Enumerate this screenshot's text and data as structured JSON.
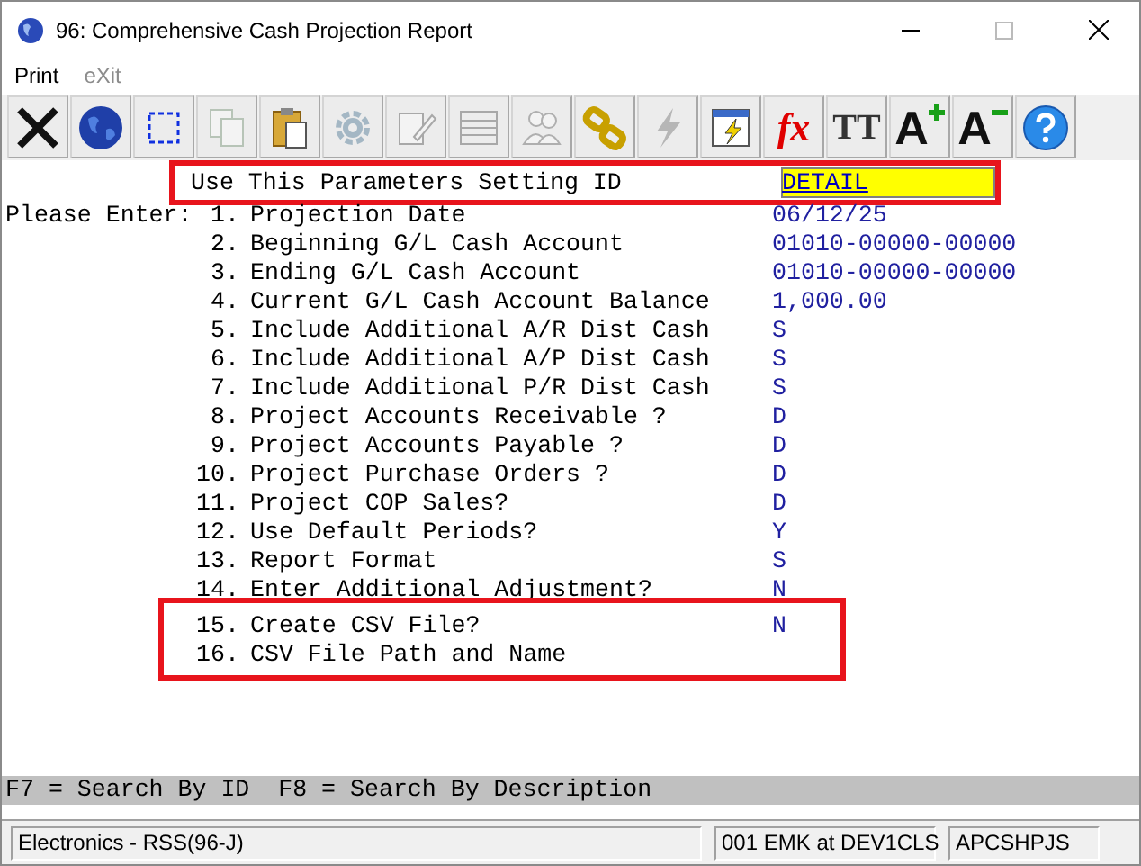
{
  "window": {
    "title": "96: Comprehensive Cash Projection Report"
  },
  "menu": [
    {
      "label": "Print",
      "disabled": false
    },
    {
      "label": "eXit",
      "disabled": true
    }
  ],
  "toolbar": [
    {
      "kind": "close",
      "disabled": false
    },
    {
      "kind": "globe",
      "disabled": false
    },
    {
      "kind": "select",
      "disabled": false
    },
    {
      "kind": "copy",
      "disabled": true
    },
    {
      "kind": "paste",
      "disabled": false
    },
    {
      "kind": "gear",
      "disabled": true
    },
    {
      "kind": "edit",
      "disabled": true
    },
    {
      "kind": "table",
      "disabled": true
    },
    {
      "kind": "users",
      "disabled": true
    },
    {
      "kind": "link",
      "disabled": false
    },
    {
      "kind": "bolt",
      "disabled": true
    },
    {
      "kind": "window-bolt",
      "disabled": false
    },
    {
      "kind": "glyph",
      "glyph": "fx",
      "disabled": false
    },
    {
      "kind": "fonts",
      "glyph": "TT",
      "disabled": false
    },
    {
      "kind": "font-plus",
      "glyph": "A",
      "disabled": false
    },
    {
      "kind": "font-minus",
      "glyph": "A",
      "disabled": false
    },
    {
      "kind": "help",
      "disabled": false
    }
  ],
  "parameter": {
    "label": "Use This Parameters Setting ID",
    "value": "DETAIL"
  },
  "prompt": "Please Enter:",
  "fields": [
    {
      "number": "1.",
      "label": "Projection Date",
      "value": "06/12/25",
      "highlighted": false
    },
    {
      "number": "2.",
      "label": "Beginning G/L Cash Account",
      "value": "01010-00000-00000",
      "highlighted": false
    },
    {
      "number": "3.",
      "label": "Ending G/L Cash Account",
      "value": "01010-00000-00000",
      "highlighted": false
    },
    {
      "number": "4.",
      "label": "Current G/L Cash Account Balance",
      "value": "1,000.00",
      "highlighted": false
    },
    {
      "number": "5.",
      "label": "Include Additional A/R Dist Cash",
      "value": "S",
      "highlighted": false
    },
    {
      "number": "6.",
      "label": "Include Additional A/P Dist Cash",
      "value": "S",
      "highlighted": false
    },
    {
      "number": "7.",
      "label": "Include Additional P/R Dist Cash",
      "value": "S",
      "highlighted": false
    },
    {
      "number": "8.",
      "label": "Project Accounts Receivable ?",
      "value": "D",
      "highlighted": false
    },
    {
      "number": "9.",
      "label": "Project Accounts Payable ?",
      "value": "D",
      "highlighted": false
    },
    {
      "number": "10.",
      "label": "Project Purchase Orders ?",
      "value": "D",
      "highlighted": false
    },
    {
      "number": "11.",
      "label": "Project COP Sales?",
      "value": "D",
      "highlighted": false
    },
    {
      "number": "12.",
      "label": "Use Default Periods?",
      "value": "Y",
      "highlighted": false
    },
    {
      "number": "13.",
      "label": "Report Format",
      "value": "S",
      "highlighted": false
    },
    {
      "number": "14.",
      "label": "Enter Additional Adjustment?",
      "value": "N",
      "highlighted": false
    },
    {
      "number": "15.",
      "label": "Create CSV File?",
      "value": "N",
      "highlighted": true
    },
    {
      "number": "16.",
      "label": "CSV File Path and Name",
      "highlighted": true
    }
  ],
  "hint_bar": "F7 = Search By ID  F8 = Search By Description",
  "status_bar": [
    "Electronics - RSS(96-J)",
    "001 EMK at DEV1CLS",
    "APCSHPJS"
  ]
}
